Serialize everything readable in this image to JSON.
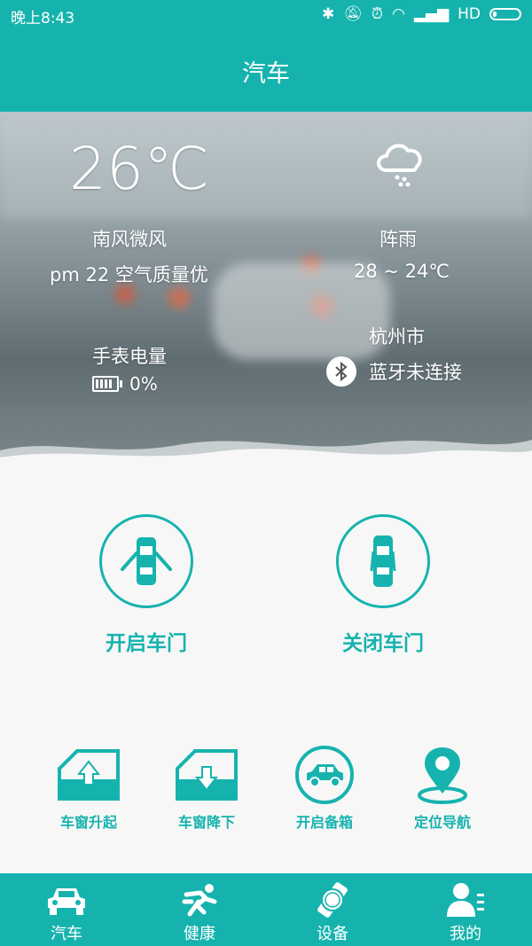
{
  "status": {
    "time": "晚上8:43",
    "network": "HD"
  },
  "header": {
    "title": "汽车"
  },
  "weather": {
    "temperature": "26℃",
    "wind": "南风微风",
    "air_quality": "pm 22 空气质量优",
    "watch_battery_label": "手表电量",
    "watch_battery_value": "0%",
    "condition": "阵雨",
    "temp_range": "28 ~ 24℃",
    "city": "杭州市",
    "bluetooth_status": "蓝牙未连接"
  },
  "doors": {
    "open_label": "开启车门",
    "close_label": "关闭车门"
  },
  "actions": {
    "window_up": "车窗升起",
    "window_down": "车窗降下",
    "trunk": "开启备箱",
    "navigation": "定位导航"
  },
  "nav": {
    "items": [
      {
        "label": "汽车",
        "icon": "car-icon"
      },
      {
        "label": "健康",
        "icon": "runner-icon"
      },
      {
        "label": "设备",
        "icon": "watch-icon"
      },
      {
        "label": "我的",
        "icon": "profile-icon"
      }
    ]
  },
  "colors": {
    "accent": "#16b3ae"
  }
}
